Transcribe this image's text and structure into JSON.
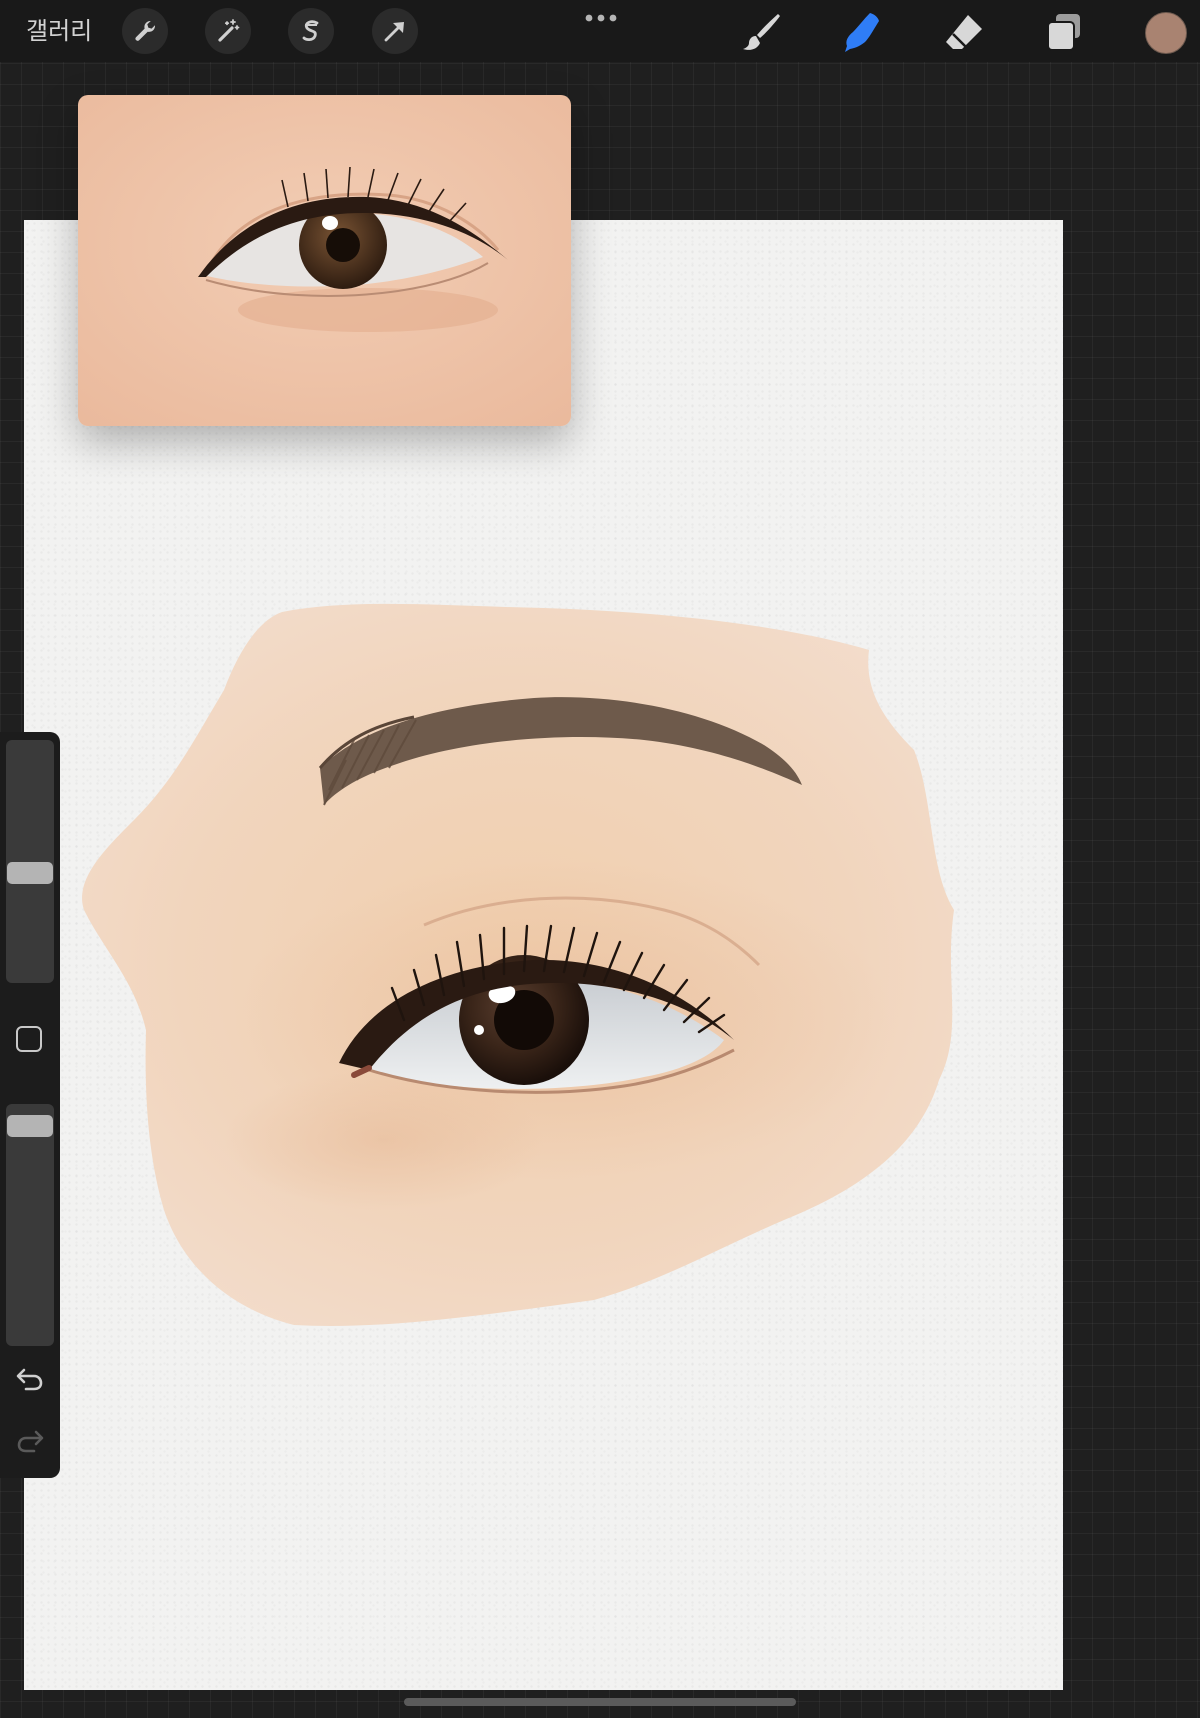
{
  "toolbar": {
    "gallery_label": "갤러리",
    "left_tools": [
      "wrench-icon",
      "magic-wand-icon",
      "selection-s-icon",
      "arrow-transform-icon"
    ],
    "more_icon": "ellipsis-icon",
    "right_tools": [
      "brush-icon",
      "smudge-icon",
      "eraser-icon",
      "layers-icon"
    ],
    "active_tool": "smudge",
    "active_tool_color": "#2f7df6",
    "current_color": "#a98371"
  },
  "sidebar": {
    "size_slider_level": 0.45,
    "opacity_slider_level": 0.95,
    "icons": [
      "square-modify-icon",
      "undo-icon",
      "redo-icon"
    ]
  },
  "reference": {
    "description_icon": "reference-photo-eye"
  },
  "colors": {
    "background": "#1f1f1f",
    "canvas": "#f2f2f1",
    "skin_wash": "#f0d2b6",
    "brow": "#6e5a4b"
  }
}
